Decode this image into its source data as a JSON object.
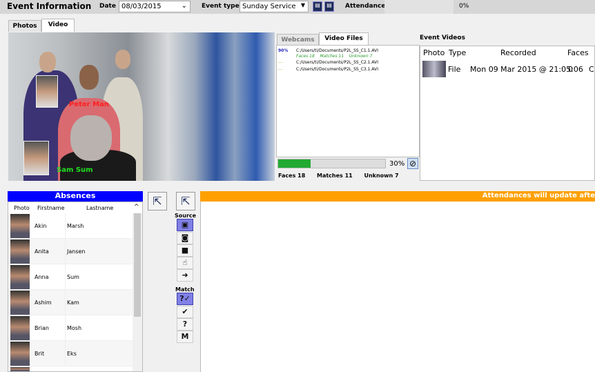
{
  "header": {
    "title": "Event Information",
    "date_label": "Date",
    "date_value": "08/03/2015",
    "event_type_label": "Event type",
    "event_type_value": "Sunday Service",
    "attendance_label": "Attendance",
    "attendance_percent": "0%"
  },
  "tabs": [
    {
      "label": "Photos"
    },
    {
      "label": "Video",
      "active": true
    }
  ],
  "video": {
    "labels": [
      {
        "text": "Peter Man",
        "color": "#ff2020"
      },
      {
        "text": "Sam Sum",
        "color": "#20e020"
      }
    ]
  },
  "source_tabs": [
    {
      "label": "Webcams"
    },
    {
      "label": "Video Files",
      "active": true
    }
  ],
  "files": [
    {
      "progress": "90%",
      "path": "C:/Users/ti/Documents/P2L_SS_C1.1.AVI",
      "faces_label": "Faces",
      "faces": "18",
      "matches_label": "Matches",
      "matches": "11",
      "unknown_label": "Unknown",
      "unknown": "7"
    },
    {
      "progress": "---",
      "path": "C:/Users/ti/Documents/P2L_SS_C2.1.AVI"
    },
    {
      "progress": "---",
      "path": "C:/Users/ti/Documents/P2L_SS_C3.1.AVI"
    }
  ],
  "progress": {
    "value": 30,
    "label": "30%",
    "bar_color": "#22aa33"
  },
  "stats": {
    "faces_label": "Faces",
    "faces": "18",
    "matches_label": "Matches",
    "matches": "11",
    "unknown_label": "Unknown",
    "unknown": "7"
  },
  "event_videos": {
    "title": "Event Videos",
    "columns": [
      "Photo",
      "Type",
      "Recorded",
      "Faces",
      "C"
    ],
    "rows": [
      {
        "type": "File",
        "recorded": "Mon 09 Mar 2015 @ 21:05:06",
        "faces": "0",
        "extra": "C"
      }
    ]
  },
  "absences": {
    "title": "Absences",
    "header_color": "#0000ff",
    "columns": [
      "Photo",
      "Firstname",
      "Lastname"
    ],
    "rows": [
      {
        "first": "Akin",
        "last": "Marsh"
      },
      {
        "first": "Anita",
        "last": "Jansen"
      },
      {
        "first": "Anna",
        "last": "Sum"
      },
      {
        "first": "Ashim",
        "last": "Kam"
      },
      {
        "first": "Brian",
        "last": "Mosh"
      },
      {
        "first": "Brit",
        "last": "Eks"
      }
    ]
  },
  "tools": {
    "source_label": "Source",
    "match_label": "Match",
    "source_icons": [
      "webcam-and-camera-icon",
      "camera-icon",
      "video-camera-icon",
      "touch-icon",
      "arrow-right-icon"
    ],
    "match_icons": [
      "question-check-icon",
      "check-icon",
      "question-icon",
      "m-icon"
    ]
  },
  "attendances": {
    "banner": "Attendances will update afte",
    "banner_color": "#ffa000"
  }
}
